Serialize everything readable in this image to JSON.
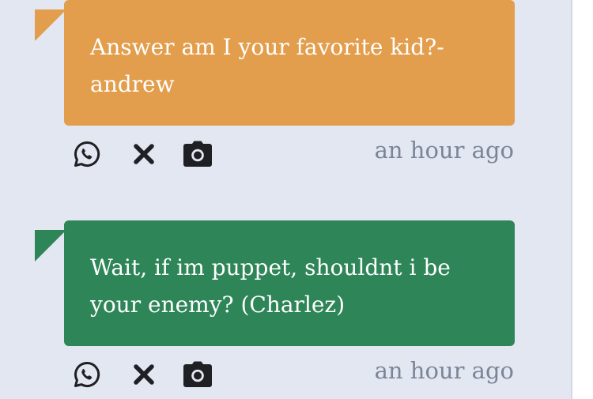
{
  "messages": [
    {
      "text": "Answer am I your favorite kid?- andrew",
      "color": "#e29e4d",
      "timestamp": "an hour ago",
      "icons": [
        "whatsapp-icon",
        "close-icon",
        "camera-icon"
      ]
    },
    {
      "text": "Wait, if im puppet, shouldnt i be your enemy? (Charlez)",
      "color": "#2e8558",
      "timestamp": "an hour ago",
      "icons": [
        "whatsapp-icon",
        "close-icon",
        "camera-icon"
      ]
    }
  ],
  "colors": {
    "background": "#e3e7f1",
    "icon": "#1f2024",
    "timestamp": "#7b8598"
  }
}
